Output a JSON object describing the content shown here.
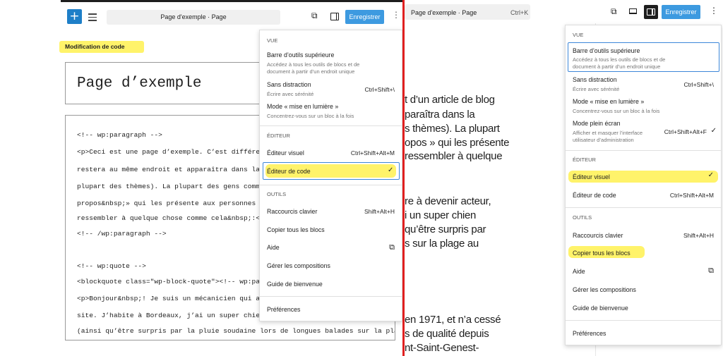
{
  "left": {
    "doc_title": "Page d'exemple · Page",
    "save_label": "Enregistrer",
    "annotation": "Modification de code",
    "page_title": "Page d’exemple",
    "code_lines": [
      "<!-- wp:paragraph -->",
      "<p>Ceci est une page d’exemple. C’est différent d",
      "restera au même endroit et apparaîtra dans la nav",
      "plupart des thèmes). La plupart des gens commence",
      "propos&nbsp;» qui les présente aux personnes visi",
      "ressembler à quelque chose comme cela&nbsp;:</p>",
      "<!-- /wp:paragraph -->",
      "",
      "<!-- wp:quote -->",
      "<blockquote class=\"wp-block-quote\"><!-- wp:paragr",
      "<p>Bonjour&nbsp;! Je suis un mécanicien qui aspir",
      "site. J’habite à Bordeaux, j’ai un super chien ba",
      "(ainsi qu’être surpris par la pluie soudaine lors de longues balades sur la plage"
    ],
    "menu": {
      "vue_heading": "VUE",
      "items_vue": [
        {
          "label": "Barre d’outils supérieure",
          "desc1": "Accédez à tous les outils de blocs et de",
          "desc2": "document à partir d’un endroit unique",
          "shortcut": ""
        },
        {
          "label": "Sans distraction",
          "desc1": "Écrire avec sérénité",
          "desc2": "",
          "shortcut": "Ctrl+Shift+\\"
        },
        {
          "label": "Mode « mise en lumière »",
          "desc1": "Concentrez-vous sur un bloc à la fois",
          "desc2": "",
          "shortcut": ""
        }
      ],
      "editeur_heading": "ÉDITEUR",
      "editeur_visuel": "Éditeur visuel",
      "editeur_visuel_short": "Ctrl+Shift+Alt+M",
      "editeur_code": "Éditeur de code",
      "outils_heading": "OUTILS",
      "raccourcis": "Raccourcis clavier",
      "raccourcis_short": "Shift+Alt+H",
      "copier": "Copier tous les blocs",
      "aide": "Aide",
      "compositions": "Gérer les compositions",
      "guide": "Guide de bienvenue",
      "preferences": "Préférences"
    }
  },
  "right": {
    "doc_title": "Page d'exemple · Page",
    "doc_shortcut": "Ctrl+K",
    "save_label": "Enregistrer",
    "prose_lines": [
      "t d’un article de blog",
      "paraîtra dans la",
      "s thèmes). La plupart",
      "opos » qui les présente",
      "ressembler à quelque",
      "re à devenir acteur,",
      "i un super chien",
      "qu’être surpris par",
      "s sur la plage au",
      "en 1971, et n’a cessé",
      "s de qualité depuis",
      "nt-Saint-Genest-"
    ],
    "menu": {
      "vue_heading": "VUE",
      "items_vue": [
        {
          "label": "Barre d’outils supérieure",
          "desc1": "Accédez à tous les outils de blocs et de",
          "desc2": "document à partir d’un endroit unique",
          "shortcut": ""
        },
        {
          "label": "Sans distraction",
          "desc1": "Écrire avec sérénité",
          "desc2": "",
          "shortcut": "Ctrl+Shift+\\"
        },
        {
          "label": "Mode « mise en lumière »",
          "desc1": "Concentrez-vous sur un bloc à la fois",
          "desc2": "",
          "shortcut": ""
        },
        {
          "label": "Mode plein écran",
          "desc1": "Afficher et masquer l’interface",
          "desc2": "utilisateur d’administration",
          "shortcut": "Ctrl+Shift+Alt+F"
        }
      ],
      "editeur_heading": "ÉDITEUR",
      "editeur_visuel": "Éditeur visuel",
      "editeur_code": "Éditeur de code",
      "editeur_code_short": "Ctrl+Shift+Alt+M",
      "outils_heading": "OUTILS",
      "raccourcis": "Raccourcis clavier",
      "raccourcis_short": "Shift+Alt+H",
      "copier": "Copier tous les blocs",
      "aide": "Aide",
      "compositions": "Gérer les compositions",
      "guide": "Guide de bienvenue",
      "preferences": "Préférences"
    }
  },
  "colors": {
    "accent": "#3d9ae0",
    "highlight": "#fff36a",
    "divider": "#e02020"
  }
}
